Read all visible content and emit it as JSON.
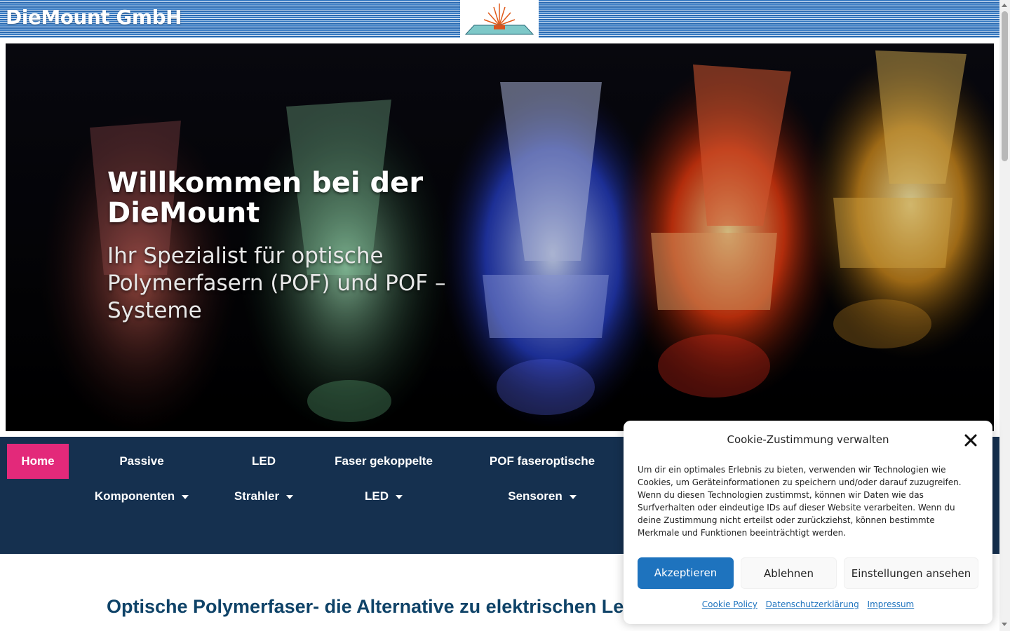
{
  "header": {
    "brand": "DieMount GmbH"
  },
  "hero": {
    "title": "Willkommen bei der DieMount",
    "subtitle": "Ihr Spezialist für optische Polymerfasern (POF) und POF – Systeme"
  },
  "nav": {
    "home": "Home",
    "items": [
      {
        "line1": "Passive",
        "line2": "Komponenten"
      },
      {
        "line1": "LED",
        "line2": "Strahler"
      },
      {
        "line1": "Faser gekoppelte",
        "line2": "LED"
      },
      {
        "line1": "POF faseroptische",
        "line2": "Sensoren"
      }
    ]
  },
  "content": {
    "heading": "Optische Polymerfaser- die Alternative zu elektrischen Leit"
  },
  "cookie": {
    "title": "Cookie-Zustimmung verwalten",
    "text": "Um dir ein optimales Erlebnis zu bieten, verwenden wir Technologien wie Cookies, um Geräteinformationen zu speichern und/oder darauf zuzugreifen. Wenn du diesen Technologien zustimmst, können wir Daten wie das Surfverhalten oder eindeutige IDs auf dieser Website verarbeiten. Wenn du deine Zustimmung nicht erteilst oder zurückziehst, können bestimmte Merkmale und Funktionen beeinträchtigt werden.",
    "accept": "Akzeptieren",
    "deny": "Ablehnen",
    "settings": "Einstellungen ansehen",
    "links": [
      "Cookie Policy",
      "Datenschutzerklärung",
      "Impressum"
    ]
  },
  "colors": {
    "nav_bg": "#15304f",
    "home_active": "#e3297a",
    "accept_button": "#1e73be",
    "heading": "#0f4368"
  }
}
